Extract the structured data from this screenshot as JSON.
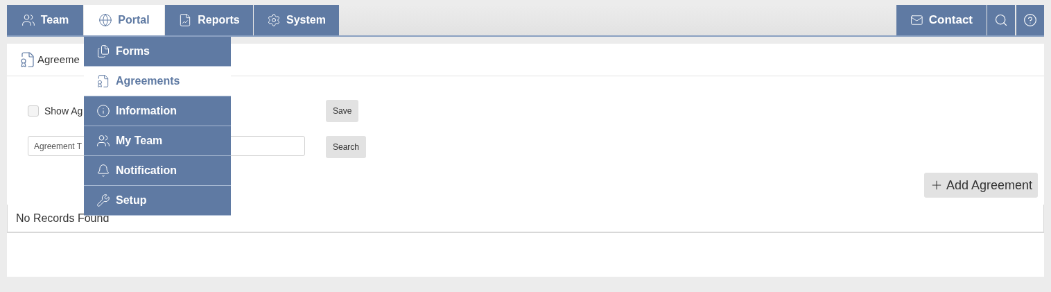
{
  "nav_tabs": [
    {
      "label": "Team",
      "selected": false
    },
    {
      "label": "Portal",
      "selected": true
    },
    {
      "label": "Reports",
      "selected": false
    },
    {
      "label": "System",
      "selected": false
    }
  ],
  "nav_right": {
    "contact": "Contact"
  },
  "portal_menu": [
    {
      "label": "Forms",
      "selected": false
    },
    {
      "label": "Agreements",
      "selected": true
    },
    {
      "label": "Information",
      "selected": false
    },
    {
      "label": "My Team",
      "selected": false
    },
    {
      "label": "Notification",
      "selected": false
    },
    {
      "label": "Setup",
      "selected": false
    }
  ],
  "panel": {
    "title": "Agreeme",
    "show_checkbox": {
      "label": "Show Ag",
      "checked": false
    },
    "save_button": "Save",
    "search_field": {
      "placeholder": "Agreement T"
    },
    "search_button": "Search",
    "add_button": "Add Agreement",
    "table": {
      "empty_message": "No Records Found"
    }
  }
}
